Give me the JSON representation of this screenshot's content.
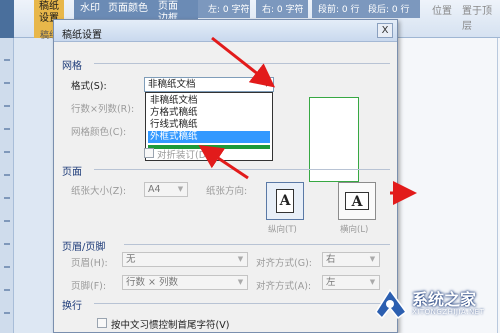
{
  "ribbon": {
    "btn_paper": "稿纸\n设置",
    "group_paper": "稿纸",
    "btn_watermark": "水印",
    "btn_page_color": "页面颜色",
    "btn_page_border": "页面\n边框",
    "left_indent": "左: 0 字符",
    "right_indent": "右: 0 字符",
    "spacing_before": "段前: 0 行",
    "spacing_after": "段后: 0 行",
    "position": "位置",
    "arrange_front": "置于顶层",
    "arrange_back": "置于底层"
  },
  "dialog": {
    "title": "稿纸设置",
    "close": "X",
    "grid": {
      "section": "网格",
      "format_label": "格式(S):",
      "format_value": "非稿纸文档",
      "rows_cols_label": "行数×列数(R):",
      "grid_color_label": "网格颜色(C):",
      "fold_label": "对折装订(D)",
      "dropdown_items": [
        "非稿纸文档",
        "方格式稿纸",
        "行线式稿纸",
        "外框式稿纸"
      ],
      "dropdown_selected_index": 3
    },
    "page": {
      "section": "页面",
      "size_label": "纸张大小(Z):",
      "size_value": "A4",
      "orientation_label": "纸张方向:",
      "portrait": "纵向(T)",
      "landscape": "横向(L)",
      "page_glyph": "A"
    },
    "header_footer": {
      "section": "页眉/页脚",
      "header_label": "页眉(H):",
      "header_value": "无",
      "header_align_label": "对齐方式(G):",
      "header_align_value": "右",
      "footer_label": "页脚(F):",
      "footer_value": "行数 × 列数",
      "footer_align_label": "对齐方式(A):",
      "footer_align_value": "左"
    },
    "line_break": {
      "section": "换行",
      "rule_label": "按中文习惯控制首尾字符(V)"
    }
  },
  "watermark": {
    "text": "系统之家",
    "url": "XITONGZHIJIA.NET"
  },
  "colors": {
    "arrow": "#e21b1b",
    "selection": "#3399ff",
    "preview_border": "#37a843",
    "progress": "#1e9a3a"
  }
}
